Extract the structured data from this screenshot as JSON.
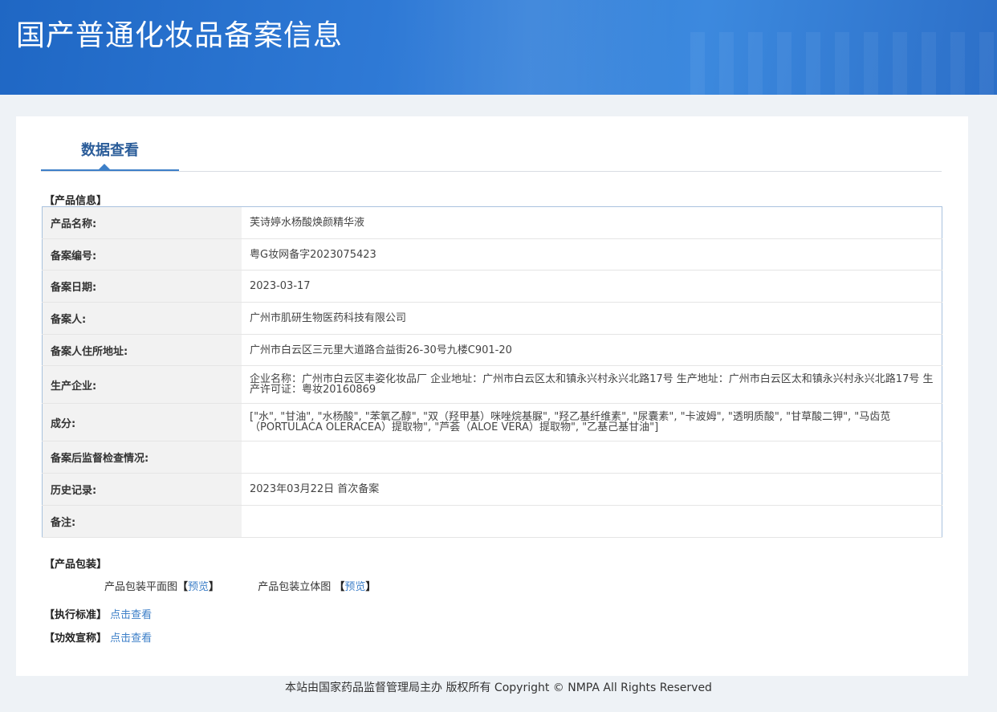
{
  "header": {
    "title": "国产普通化妆品备案信息"
  },
  "tabs": [
    {
      "label": "数据查看"
    }
  ],
  "product_info": {
    "section_title": "【产品信息】",
    "rows": [
      {
        "label": "产品名称:",
        "value": "芙诗婷水杨酸焕颜精华液"
      },
      {
        "label": "备案编号:",
        "value": "粤G妆网备字2023075423"
      },
      {
        "label": "备案日期:",
        "value": "2023-03-17"
      },
      {
        "label": "备案人:",
        "value": "广州市肌研生物医药科技有限公司"
      },
      {
        "label": "备案人住所地址:",
        "value": "广州市白云区三元里大道路合益街26-30号九楼C901-20"
      },
      {
        "label": "生产企业:",
        "value": "企业名称：广州市白云区丰姿化妆品厂 企业地址：广州市白云区太和镇永兴村永兴北路17号 生产地址：广州市白云区太和镇永兴村永兴北路17号 生产许可证：粤妆20160869"
      },
      {
        "label": "成分:",
        "value": "[\"水\", \"甘油\", \"水杨酸\", \"苯氧乙醇\", \"双（羟甲基）咪唑烷基脲\", \"羟乙基纤维素\", \"尿囊素\", \"卡波姆\", \"透明质酸\", \"甘草酸二钾\", \"马齿苋（PORTULACA OLERACEA）提取物\", \"芦荟（ALOE VERA）提取物\", \"乙基己基甘油\"]"
      },
      {
        "label": "备案后监督检查情况:",
        "value": ""
      },
      {
        "label": "历史记录:",
        "value": "2023年03月22日 首次备案"
      },
      {
        "label": "备注:",
        "value": ""
      }
    ]
  },
  "packaging": {
    "section_title": "【产品包装】",
    "flat": {
      "label": "产品包装平面图",
      "link": "预览"
    },
    "three_d": {
      "label": "产品包装立体图",
      "link": "预览"
    }
  },
  "standard": {
    "title": "【执行标准】",
    "link": "点击查看"
  },
  "efficacy": {
    "title": "【功效宣称】",
    "link": "点击查看"
  },
  "footer": {
    "text": "本站由国家药品监督管理局主办 版权所有 Copyright © NMPA All Rights Reserved"
  }
}
